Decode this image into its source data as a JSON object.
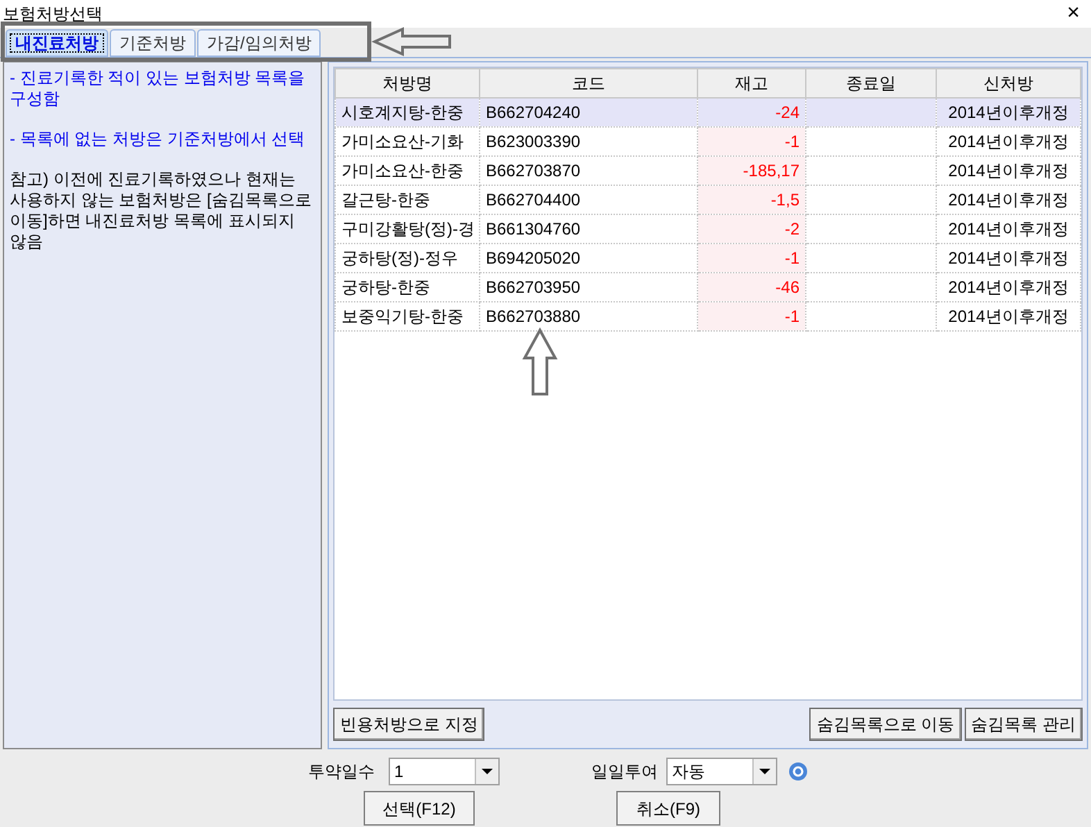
{
  "window": {
    "title": "보험처방선택",
    "close": "×"
  },
  "tabs": [
    {
      "label": "내진료처방",
      "selected": true
    },
    {
      "label": "기준처방",
      "selected": false
    },
    {
      "label": "가감/임의처방",
      "selected": false
    }
  ],
  "info_panel": {
    "notes": [
      {
        "kind": "highlight",
        "text": "- 진료기록한 적이 있는 보험처방 목록을 구성함"
      },
      {
        "kind": "highlight",
        "text": "- 목록에 없는 처방은 기준처방에서 선택"
      },
      {
        "kind": "plain",
        "text": "참고) 이전에 진료기록하였으나 현재는 사용하지 않는 보험처방은 [숨김목록으로 이동]하면 내진료처방 목록에 표시되지 않음"
      }
    ]
  },
  "table": {
    "columns": [
      "처방명",
      "코드",
      "재고",
      "종료일",
      "신처방"
    ],
    "rows": [
      {
        "name": "시호계지탕-한중",
        "code": "B662704240",
        "stock": "-24",
        "end_date": "",
        "new": "2014년이후개정",
        "selected": true
      },
      {
        "name": "가미소요산-기화",
        "code": "B623003390",
        "stock": "-1",
        "end_date": "",
        "new": "2014년이후개정",
        "selected": false
      },
      {
        "name": "가미소요산-한중",
        "code": "B662703870",
        "stock": "-185,17",
        "end_date": "",
        "new": "2014년이후개정",
        "selected": false
      },
      {
        "name": "갈근탕-한중",
        "code": "B662704400",
        "stock": "-1,5",
        "end_date": "",
        "new": "2014년이후개정",
        "selected": false
      },
      {
        "name": "구미강활탕(정)-경",
        "code": "B661304760",
        "stock": "-2",
        "end_date": "",
        "new": "2014년이후개정",
        "selected": false
      },
      {
        "name": "궁하탕(정)-정우",
        "code": "B694205020",
        "stock": "-1",
        "end_date": "",
        "new": "2014년이후개정",
        "selected": false
      },
      {
        "name": "궁하탕-한중",
        "code": "B662703950",
        "stock": "-46",
        "end_date": "",
        "new": "2014년이후개정",
        "selected": false
      },
      {
        "name": "보중익기탕-한중",
        "code": "B662703880",
        "stock": "-1",
        "end_date": "",
        "new": "2014년이후개정",
        "selected": false
      }
    ]
  },
  "list_buttons_left": [
    "빈용처방으로 지정"
  ],
  "list_buttons_right": [
    "숨김목록으로 이동",
    "숨김목록 관리"
  ],
  "footer": {
    "days_label": "투약일수",
    "days_value": "1",
    "daily_label": "일일투여",
    "daily_value": "자동",
    "buttons": [
      "선택(F12)",
      "취소(F9)"
    ]
  }
}
